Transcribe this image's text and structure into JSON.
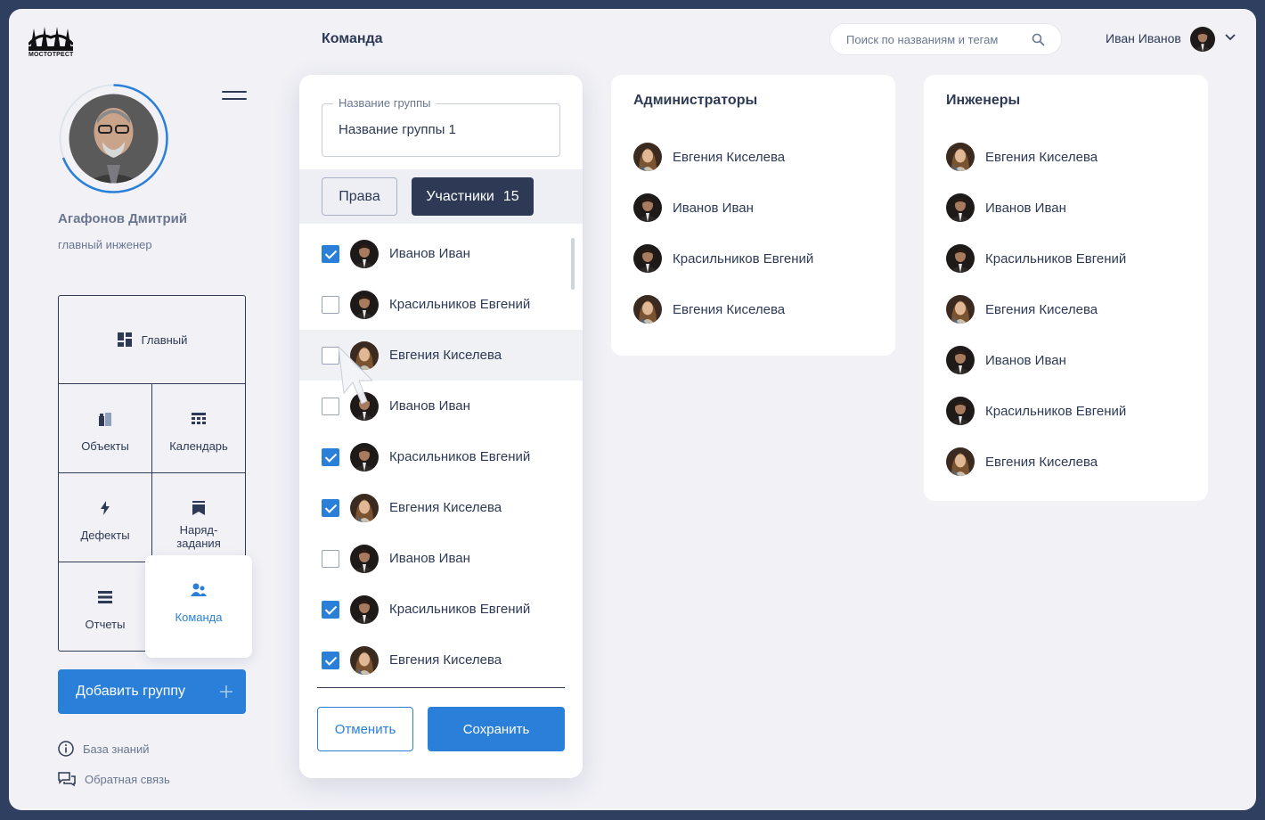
{
  "brand": {
    "logo_text": "МОСТОТРЕСТ"
  },
  "profile": {
    "name": "Агафонов Дмитрий",
    "role": "главный инженер"
  },
  "nav": {
    "main": "Главный",
    "objects": "Объекты",
    "calendar": "Календарь",
    "defects": "Дефекты",
    "tasks_line1": "Наряд-",
    "tasks_line2": "задания",
    "reports": "Отчеты",
    "team": "Команда"
  },
  "add_group_label": "Добавить группу",
  "links": {
    "knowledge": "База знаний",
    "feedback": "Обратная связь"
  },
  "header": {
    "title": "Команда",
    "search_placeholder": "Поиск по названиям и тегам",
    "user_name": "Иван Иванов"
  },
  "group_form": {
    "field_label": "Название группы",
    "field_value": "Название группы 1",
    "tab_rights": "Права",
    "tab_members": "Участники",
    "members_count": "15",
    "members": [
      {
        "name": "Иванов Иван",
        "checked": true
      },
      {
        "name": "Красильников Евгений",
        "checked": false
      },
      {
        "name": "Евгения Киселева",
        "checked": false
      },
      {
        "name": "Иванов Иван",
        "checked": false
      },
      {
        "name": "Красильников Евгений",
        "checked": true
      },
      {
        "name": "Евгения Киселева",
        "checked": true
      },
      {
        "name": "Иванов Иван",
        "checked": false
      },
      {
        "name": "Красильников Евгений",
        "checked": true
      },
      {
        "name": "Евгения Киселева",
        "checked": true
      }
    ],
    "cancel_label": "Отменить",
    "save_label": "Сохранить"
  },
  "groups": [
    {
      "title": "Администраторы",
      "members": [
        "Евгения Киселева",
        "Иванов Иван",
        "Красильников Евгений",
        "Евгения Киселева"
      ]
    },
    {
      "title": "Инженеры",
      "members": [
        "Евгения Киселева",
        "Иванов Иван",
        "Красильников Евгений",
        "Евгения Киселева",
        "Иванов Иван",
        "Красильников Евгений",
        "Евгения Киселева"
      ]
    }
  ],
  "colors": {
    "accent": "#2a7fd8",
    "dark": "#2e3a55",
    "frame": "#2f3f5f",
    "background": "#f1f1f6"
  }
}
